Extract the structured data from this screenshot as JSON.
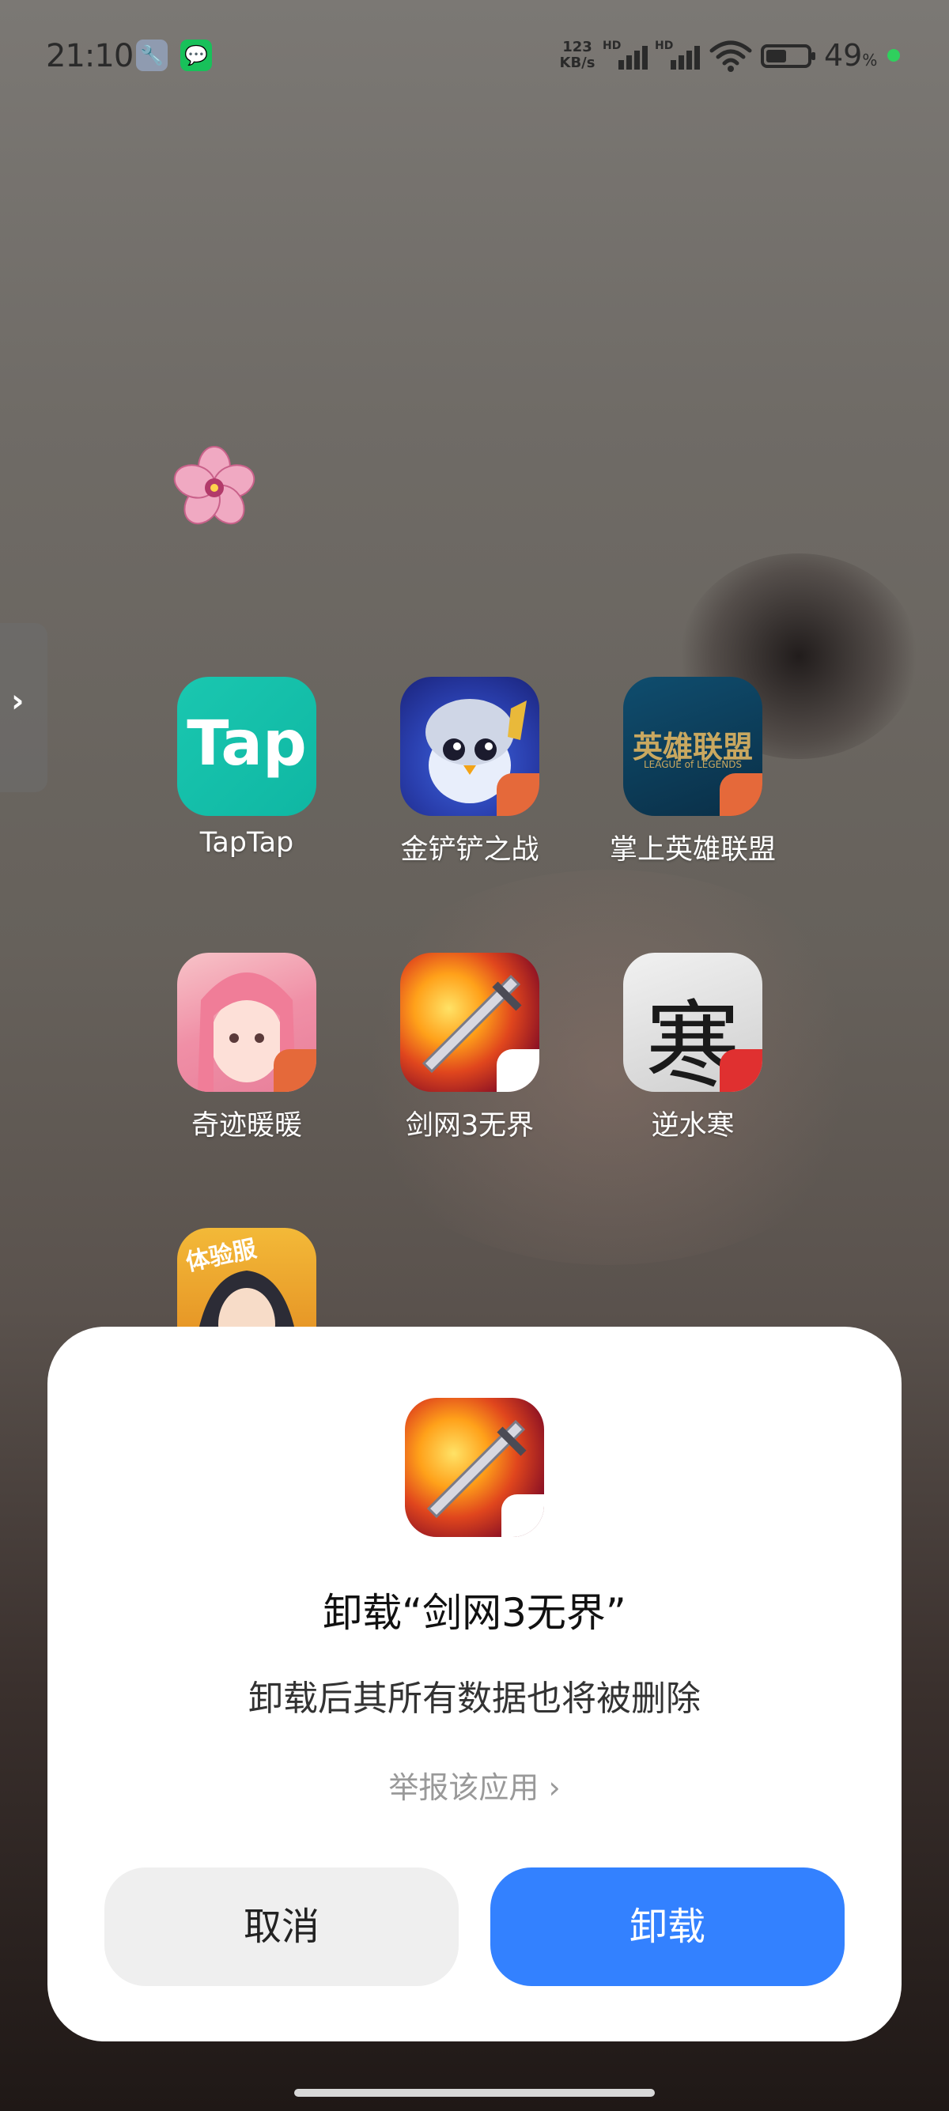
{
  "status_bar": {
    "time": "21:10",
    "net_speed_value": "123",
    "net_speed_unit": "KB/s",
    "hd_label": "HD",
    "battery_percent": "49",
    "battery_unit": "%",
    "battery_level": 0.49,
    "notification_icons": [
      "wrench-icon",
      "wechat-icon"
    ]
  },
  "apps": [
    {
      "label": "TapTap",
      "icon_text": "Tap"
    },
    {
      "label": "金铲铲之战"
    },
    {
      "label": "掌上英雄联盟",
      "icon_text": "英雄联盟",
      "icon_subtext": "LEAGUE of LEGENDS"
    },
    {
      "label": "奇迹暖暖"
    },
    {
      "label": "剑网3无界"
    },
    {
      "label": "逆水寒",
      "icon_text": "寒"
    },
    {
      "icon_text": "体验服"
    }
  ],
  "dialog": {
    "title": "卸载“剑网3无界”",
    "message": "卸载后其所有数据也将被删除",
    "report_link": "举报该应用 ›",
    "cancel_label": "取消",
    "uninstall_label": "卸载"
  },
  "colors": {
    "primary_button": "#3381ff",
    "secondary_button": "#efefef",
    "dialog_bg": "#ffffff"
  }
}
